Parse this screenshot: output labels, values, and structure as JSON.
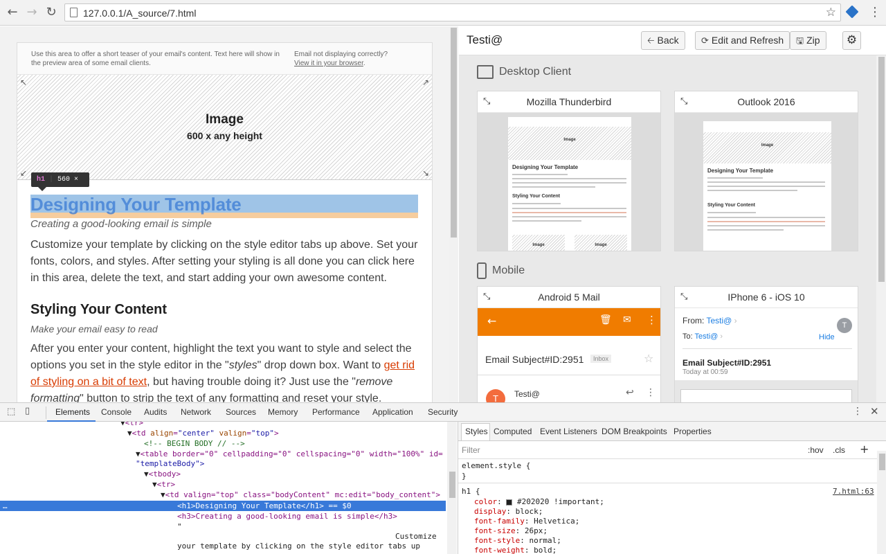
{
  "browser": {
    "url": "127.0.0.1/A_source/7.html"
  },
  "preview": {
    "preheader_left": "Use this area to offer a short teaser of your email's content. Text here will show in the preview area of some email clients.",
    "preheader_right_line1": "Email not displaying correctly?",
    "preheader_right_link": "View it in your browser",
    "preheader_right_end": ".",
    "image_label": "Image",
    "image_size": "600 x any height",
    "tooltip_tag": "h1",
    "tooltip_size": "560 × 26",
    "h1": "Designing Your Template",
    "h3": "Creating a good-looking email is simple",
    "p1": "Customize your template by clicking on the style editor tabs up above. Set your fonts, colors, and styles. After setting your styling is all done you can click here in this area, delete the text, and start adding your own awesome content.",
    "h2": "Styling Your Content",
    "h4": "Make your email easy to read",
    "p2_a": "After you enter your content, highlight the text you want to style and select the options you set in the style editor in the \"",
    "p2_styles": "styles",
    "p2_b": "\" drop down box. Want to ",
    "p2_link": "get rid of styling on a bit of text",
    "p2_c": ", but having trouble doing it? Just use the \"",
    "p2_remove": "remove formatting",
    "p2_d": "\" button to strip the text of any formatting and reset your style."
  },
  "panel": {
    "title": "Testi@",
    "back": "Back",
    "edit_refresh": "Edit and Refresh",
    "zip": "Zip",
    "desktop_section": "Desktop Client",
    "mobile_section": "Mobile",
    "clients": [
      "Mozilla Thunderbird",
      "Outlook 2016",
      "Android 5 Mail",
      "IPhone 6 - iOS 10"
    ],
    "thumb_image": "Image",
    "thumb_size": "600 x any height",
    "thumb_h1": "Designing Your Template",
    "thumb_h2": "Styling Your Content",
    "android": {
      "subject": "Email Subject#ID:2951",
      "badge": "Inbox",
      "sender": "Testi@",
      "avatar": "T"
    },
    "iphone": {
      "from_label": "From:",
      "from": "Testi@",
      "to_label": "To:",
      "to": "Testi@",
      "hide": "Hide",
      "avatar": "T",
      "subject": "Email Subject#ID:2951",
      "time": "Today at 00:59"
    }
  },
  "devtools": {
    "tabs": [
      "Elements",
      "Console",
      "Audits",
      "Network",
      "Sources",
      "Memory",
      "Performance",
      "Application",
      "Security"
    ],
    "style_tabs": [
      "Styles",
      "Computed",
      "Event Listeners",
      "DOM Breakpoints",
      "Properties"
    ],
    "filter": "Filter",
    "hov": ":hov",
    "cls": ".cls",
    "dom": {
      "l1": "<tr>",
      "l2_tag": "<td ",
      "l2_a1": "align",
      "l2_v1": "\"center\"",
      "l2_a2": "valign",
      "l2_v2": "\"top\"",
      "l3": "<!-- BEGIN BODY // -->",
      "l4": "<table border=\"0\" cellpadding=\"0\" cellspacing=\"0\" width=\"100%\" id=",
      "l5": "\"templateBody\">",
      "l6": "<tbody>",
      "l7": "<tr>",
      "l8": "<td valign=\"top\" class=\"bodyContent\" mc:edit=\"body_content\">",
      "l9": "<h1>Designing Your Template</h1> == $0",
      "l10": "<h3>Creating a good-looking email is simple</h3>",
      "l11": "\"",
      "l12": "Customize",
      "l13": "your template by clicking on the style editor tabs up"
    },
    "styles": {
      "element_style": "element.style {",
      "close": "}",
      "h1_sel": "h1 {",
      "source": "7.html:63",
      "props": [
        {
          "name": "color",
          "value": "#202020 !important;"
        },
        {
          "name": "display",
          "value": "block;"
        },
        {
          "name": "font-family",
          "value": "Helvetica;"
        },
        {
          "name": "font-size",
          "value": "26px;"
        },
        {
          "name": "font-style",
          "value": "normal;"
        },
        {
          "name": "font-weight",
          "value": "bold;"
        }
      ]
    }
  },
  "colors": {
    "accent": "#3879d9",
    "android_bar": "#f07c00",
    "link": "#d83b01",
    "iphone_blue": "#1a7de2"
  }
}
